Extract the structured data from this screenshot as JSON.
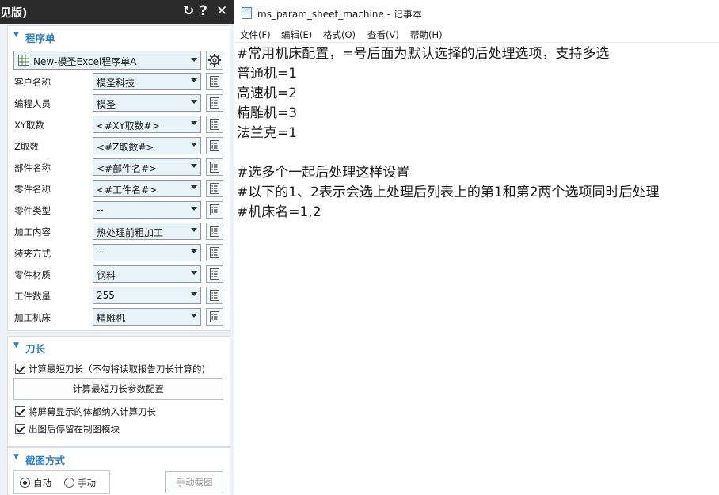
{
  "left_panel": {
    "title": "见版)",
    "refresh_icon": "↻",
    "help_label": "?",
    "close_label": "✕",
    "program_section": {
      "header": "程序单",
      "template": "New-模圣Excel程序单A",
      "rows": [
        {
          "label": "客户名称",
          "value": "模圣科技"
        },
        {
          "label": "编程人员",
          "value": "模圣"
        },
        {
          "label": "XY取数",
          "value": "<#XY取数#>"
        },
        {
          "label": "Z取数",
          "value": "<#Z取数#>"
        },
        {
          "label": "部件名称",
          "value": "<#部件名#>"
        },
        {
          "label": "零件名称",
          "value": "<#工件名#>"
        },
        {
          "label": "零件类型",
          "value": "--"
        },
        {
          "label": "加工内容",
          "value": "热处理前粗加工"
        },
        {
          "label": "装夹方式",
          "value": "--"
        },
        {
          "label": "零件材质",
          "value": "钢料"
        },
        {
          "label": "工件数量",
          "value": "255"
        },
        {
          "label": "加工机床",
          "value": "精雕机"
        }
      ]
    },
    "tool_section": {
      "header": "刀长",
      "calc_shortest": "计算最短刀长（不勾将读取报告刀长计算的)",
      "config_button": "计算最短刀长参数配置",
      "include_visible": "将屏幕显示的体都纳入计算刀长",
      "stay_after": "出图后停留在制图模块"
    },
    "capture_section": {
      "header": "截图方式",
      "auto_label": "自动",
      "manual_label": "手动",
      "manual_capture_button": "手动截图",
      "selected": "自动"
    }
  },
  "notepad": {
    "title": "ms_param_sheet_machine - 记事本",
    "menu": [
      "文件(F)",
      "编辑(E)",
      "格式(O)",
      "查看(V)",
      "帮助(H)"
    ],
    "lines": [
      "#常用机床配置，=号后面为默认选择的后处理选项，支持多选",
      "普通机=1",
      "高速机=2",
      "精雕机=3",
      "法兰克=1",
      "",
      "#选多个一起后处理这样设置",
      "#以下的1、2表示会选上处理后列表上的第1和第2两个选项同时后处理",
      "#机床名=1,2"
    ]
  },
  "colors": {
    "accent": "#2e7fc2",
    "combo_bg": "#e7f3f8",
    "panel_bg": "#eef1f5",
    "titlebar_bg": "#2b2b2b"
  }
}
